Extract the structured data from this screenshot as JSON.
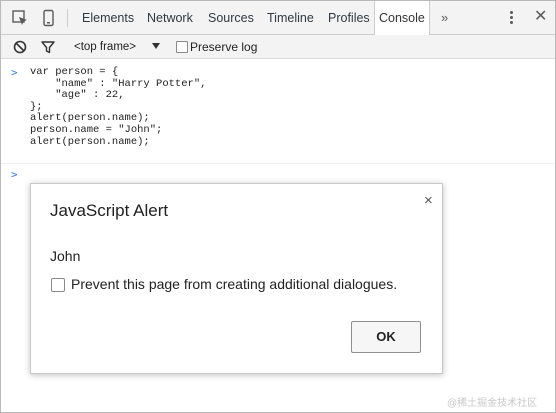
{
  "devtools": {
    "tabs": [
      "Elements",
      "Network",
      "Sources",
      "Timeline",
      "Profiles",
      "Console"
    ],
    "active_tab": "Console",
    "more_tabs": "»",
    "close": "✕"
  },
  "console_toolbar": {
    "frame_selector": "<top frame>",
    "preserve_log_label": "Preserve log"
  },
  "console": {
    "prompt": ">",
    "input_code": "var person = {\n    \"name\" : \"Harry Potter\",\n    \"age\" : 22,\n};\nalert(person.name);\nperson.name = \"John\";\nalert(person.name);",
    "empty_prompt": ">"
  },
  "alert_dialog": {
    "title": "JavaScript Alert",
    "close": "×",
    "message": "John",
    "checkbox_label": "Prevent this page from creating additional dialogues.",
    "ok_label": "OK"
  },
  "watermark": "@稀土掘金技术社区",
  "colors": {
    "toolbar_bg": "#f3f3f3",
    "prompt_blue": "#367cf1",
    "border": "#cccccc"
  },
  "icons": [
    "inspect-element-icon",
    "device-mode-icon",
    "clear-console-icon",
    "filter-icon",
    "kebab-menu-icon",
    "close-icon",
    "chevron-right-icon"
  ]
}
